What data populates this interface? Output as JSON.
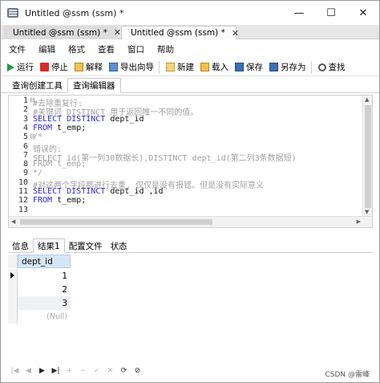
{
  "window": {
    "title": "Untitled @ssm (ssm) *",
    "controls": {
      "minimize": "—",
      "maximize": "☐",
      "close": "✕"
    }
  },
  "doc_tabs": [
    {
      "label": "Untitled @ssm (ssm) *",
      "close": "✕",
      "active": false
    },
    {
      "label": "Untitled @ssm (ssm) *",
      "close": "✕",
      "active": true
    }
  ],
  "menu": [
    "文件",
    "编辑",
    "格式",
    "查看",
    "窗口",
    "帮助"
  ],
  "toolbar": {
    "run": "运行",
    "stop": "停止",
    "explain": "解释",
    "export_wizard": "导出向导",
    "new": "新建",
    "load": "载入",
    "save": "保存",
    "save_as": "另存为",
    "find": "查找"
  },
  "sub_tabs": [
    "查询创建工具",
    "查询编辑器"
  ],
  "editor": {
    "lines": [
      {
        "n": "1",
        "fold": "⊟",
        "parts": [
          [
            "cm",
            "#去除重复行:"
          ]
        ]
      },
      {
        "n": "2",
        "fold": "",
        "parts": [
          [
            "cm",
            "#关键词 DISTINCT 用于返回唯一不同的值。"
          ]
        ]
      },
      {
        "n": "3",
        "fold": "",
        "parts": [
          [
            "kw",
            "SELECT  DISTINCT "
          ],
          [
            "id",
            "dept_id"
          ]
        ]
      },
      {
        "n": "4",
        "fold": "",
        "parts": [
          [
            "kw",
            "FROM "
          ],
          [
            "id",
            "t_emp;"
          ]
        ]
      },
      {
        "n": "5",
        "fold": "⊟",
        "parts": [
          [
            "cm",
            "/*"
          ]
        ]
      },
      {
        "n": "6",
        "fold": "",
        "parts": [
          [
            "cm",
            "错误的:"
          ]
        ]
      },
      {
        "n": "7",
        "fold": "",
        "parts": [
          [
            "cm",
            "SELECT  id(第一列30数据长),DISTINCT dept_id(第二列3条数据短)"
          ]
        ]
      },
      {
        "n": "8",
        "fold": "",
        "parts": [
          [
            "cm",
            "FROM t_emp;"
          ]
        ]
      },
      {
        "n": "9",
        "fold": "",
        "parts": [
          [
            "cm",
            "*/"
          ]
        ]
      },
      {
        "n": "10",
        "fold": "",
        "parts": [
          [
            "cm",
            "#对这两个字段都进行去重, 仅仅是没有报错。但是没有实际意义"
          ]
        ]
      },
      {
        "n": "11",
        "fold": "",
        "parts": [
          [
            "kw",
            "SELECT DISTINCT "
          ],
          [
            "id",
            "dept_id ,id"
          ]
        ]
      },
      {
        "n": "12",
        "fold": "",
        "parts": [
          [
            "kw",
            "FROM "
          ],
          [
            "id",
            "t_emp;"
          ]
        ]
      },
      {
        "n": "13",
        "fold": "",
        "parts": []
      }
    ]
  },
  "result_tabs": [
    "信息",
    "结果1",
    "配置文件",
    "状态"
  ],
  "result_grid": {
    "columns": [
      "dept_id"
    ],
    "rows": [
      "1",
      "2",
      "3",
      "(Null)"
    ]
  },
  "nav_buttons": [
    "|◀",
    "◀",
    "▶",
    "▶|",
    "+",
    "−",
    "✓",
    "✕",
    "⟳",
    "⊘"
  ],
  "watermark": "CSDN @雷峰"
}
